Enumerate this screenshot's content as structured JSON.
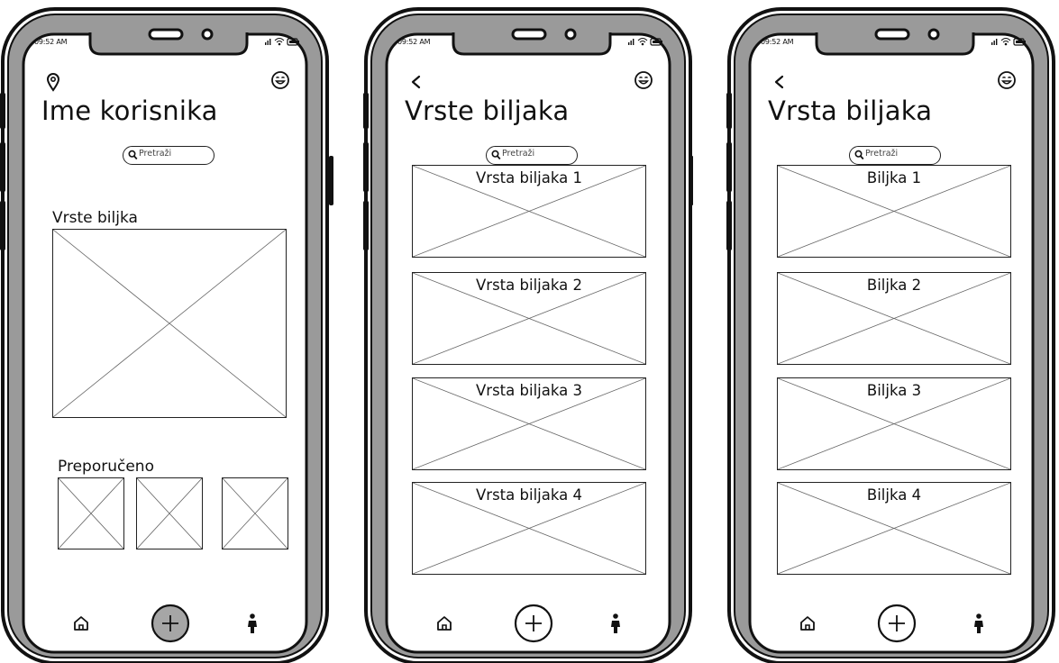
{
  "status_bar": {
    "time": "09:52 AM"
  },
  "screens": [
    {
      "title": "Ime korisnika",
      "search_placeholder": "Pretraži",
      "section_label": "Vrste biljka",
      "recommended_label": "Preporučeno"
    },
    {
      "title": "Vrste biljaka",
      "search_placeholder": "Pretraži",
      "cards": [
        {
          "label": "Vrsta biljaka 1"
        },
        {
          "label": "Vrsta biljaka 2"
        },
        {
          "label": "Vrsta biljaka 3"
        },
        {
          "label": "Vrsta biljaka 4"
        }
      ]
    },
    {
      "title": "Vrsta biljaka",
      "search_placeholder": "Pretraži",
      "cards": [
        {
          "label": "Biljka 1"
        },
        {
          "label": "Biljka 2"
        },
        {
          "label": "Biljka 3"
        },
        {
          "label": "Biljka 4"
        }
      ]
    }
  ],
  "icons": {
    "header_left_screen1": "location-pin-icon",
    "header_left_other": "back-chevron-icon",
    "header_right": "smiley-face-icon",
    "status": [
      "signal-icon",
      "wifi-icon",
      "battery-icon"
    ],
    "nav": [
      "home-icon",
      "add-icon",
      "profile-icon"
    ]
  }
}
